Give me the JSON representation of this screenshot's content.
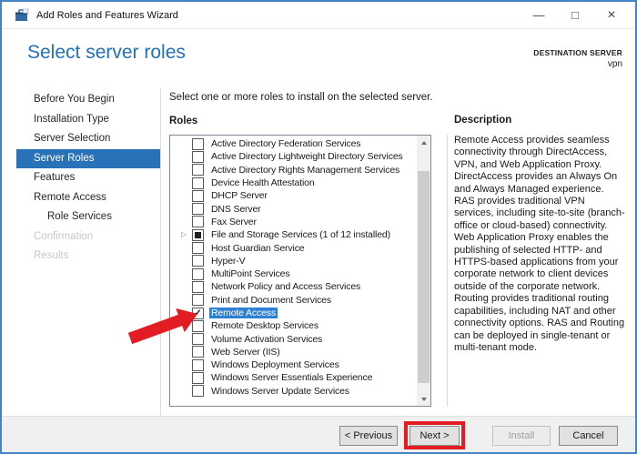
{
  "window": {
    "title": "Add Roles and Features Wizard",
    "controls": {
      "minimize": "—",
      "maximize": "□",
      "close": "×"
    }
  },
  "header": {
    "title": "Select server roles",
    "destination_label": "DESTINATION SERVER",
    "destination_value": "vpn"
  },
  "sidebar": {
    "items": [
      {
        "label": "Before You Begin",
        "state": "normal"
      },
      {
        "label": "Installation Type",
        "state": "normal"
      },
      {
        "label": "Server Selection",
        "state": "normal"
      },
      {
        "label": "Server Roles",
        "state": "selected"
      },
      {
        "label": "Features",
        "state": "normal"
      },
      {
        "label": "Remote Access",
        "state": "normal"
      },
      {
        "label": "Role Services",
        "state": "normal",
        "indent": true
      },
      {
        "label": "Confirmation",
        "state": "disabled"
      },
      {
        "label": "Results",
        "state": "disabled"
      }
    ]
  },
  "main": {
    "instruction": "Select one or more roles to install on the selected server.",
    "roles_label": "Roles",
    "expander_glyph": "▷",
    "check_glyph": "✓",
    "roles": [
      {
        "label": "Active Directory Federation Services",
        "check": "unchecked"
      },
      {
        "label": "Active Directory Lightweight Directory Services",
        "check": "unchecked"
      },
      {
        "label": "Active Directory Rights Management Services",
        "check": "unchecked"
      },
      {
        "label": "Device Health Attestation",
        "check": "unchecked"
      },
      {
        "label": "DHCP Server",
        "check": "unchecked"
      },
      {
        "label": "DNS Server",
        "check": "unchecked"
      },
      {
        "label": "Fax Server",
        "check": "unchecked"
      },
      {
        "label": "File and Storage Services (1 of 12 installed)",
        "check": "partial",
        "expander": true
      },
      {
        "label": "Host Guardian Service",
        "check": "unchecked"
      },
      {
        "label": "Hyper-V",
        "check": "unchecked"
      },
      {
        "label": "MultiPoint Services",
        "check": "unchecked"
      },
      {
        "label": "Network Policy and Access Services",
        "check": "unchecked"
      },
      {
        "label": "Print and Document Services",
        "check": "unchecked"
      },
      {
        "label": "Remote Access",
        "check": "checked",
        "selected": true
      },
      {
        "label": "Remote Desktop Services",
        "check": "unchecked"
      },
      {
        "label": "Volume Activation Services",
        "check": "unchecked"
      },
      {
        "label": "Web Server (IIS)",
        "check": "unchecked"
      },
      {
        "label": "Windows Deployment Services",
        "check": "unchecked"
      },
      {
        "label": "Windows Server Essentials Experience",
        "check": "unchecked"
      },
      {
        "label": "Windows Server Update Services",
        "check": "unchecked"
      }
    ]
  },
  "description": {
    "title": "Description",
    "body": "Remote Access provides seamless connectivity through DirectAccess, VPN, and Web Application Proxy. DirectAccess provides an Always On and Always Managed experience. RAS provides traditional VPN services, including site-to-site (branch-office or cloud-based) connectivity. Web Application Proxy enables the publishing of selected HTTP- and HTTPS-based applications from your corporate network to client devices outside of the corporate network. Routing provides traditional routing capabilities, including NAT and other connectivity options. RAS and Routing can be deployed in single-tenant or multi-tenant mode."
  },
  "footer": {
    "buttons": [
      {
        "label": "< Previous",
        "enabled": true,
        "annotated": false
      },
      {
        "label": "Next >",
        "enabled": true,
        "annotated": true
      },
      {
        "label": "Install",
        "enabled": false,
        "annotated": false
      },
      {
        "label": "Cancel",
        "enabled": true,
        "annotated": false
      }
    ]
  },
  "annotations": {
    "arrow_target": "Remote Access",
    "box_target": "Next >",
    "color": "#e31b23"
  },
  "colors": {
    "window_border": "#4484c4",
    "header_blue": "#2171b9",
    "sidebar_selection": "#2a72b8",
    "list_selection": "#2e80d4",
    "annotation_red": "#e31b23",
    "footer_bg": "#f0f0f0"
  }
}
